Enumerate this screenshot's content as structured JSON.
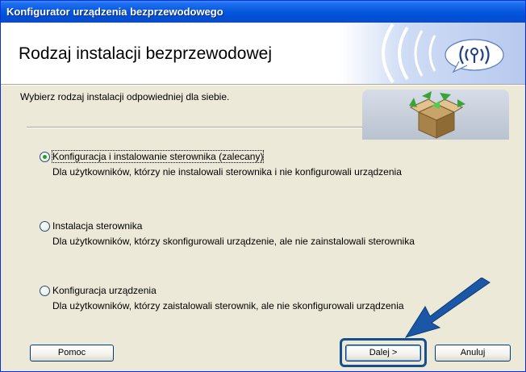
{
  "window": {
    "title": "Konfigurator urządzenia bezprzewodowego"
  },
  "header": {
    "title": "Rodzaj instalacji bezprzewodowej",
    "graphic_icon": "wireless-signal-icon"
  },
  "instruction": "Wybierz rodzaj instalacji odpowiedniej dla siebie.",
  "illustration_icon": "package-arrows-icon",
  "options": [
    {
      "label": "Konfiguracja i instalowanie sterownika (zalecany)",
      "description": "Dla użytkowników, którzy nie instalowali sterownika i nie konfigurowali urządzenia",
      "selected": true
    },
    {
      "label": "Instalacja sterownika",
      "description": "Dla użytkowników, którzy skonfigurowali urządzenie, ale nie zainstalowali sterownika",
      "selected": false
    },
    {
      "label": "Konfiguracja urządzenia",
      "description": "Dla użytkowników, którzy zaistalowali sterownik, ale nie skonfigurowali urządzenia",
      "selected": false
    }
  ],
  "buttons": {
    "help": "Pomoc",
    "next": "Dalej >",
    "cancel": "Anuluj"
  },
  "annotation": {
    "arrow_icon": "pointer-arrow-icon",
    "arrow_color": "#1a57a6"
  },
  "colors": {
    "titlebar": "#0a5ae0",
    "dialog_bg": "#ece9d8",
    "radio_selected": "#21a121"
  }
}
